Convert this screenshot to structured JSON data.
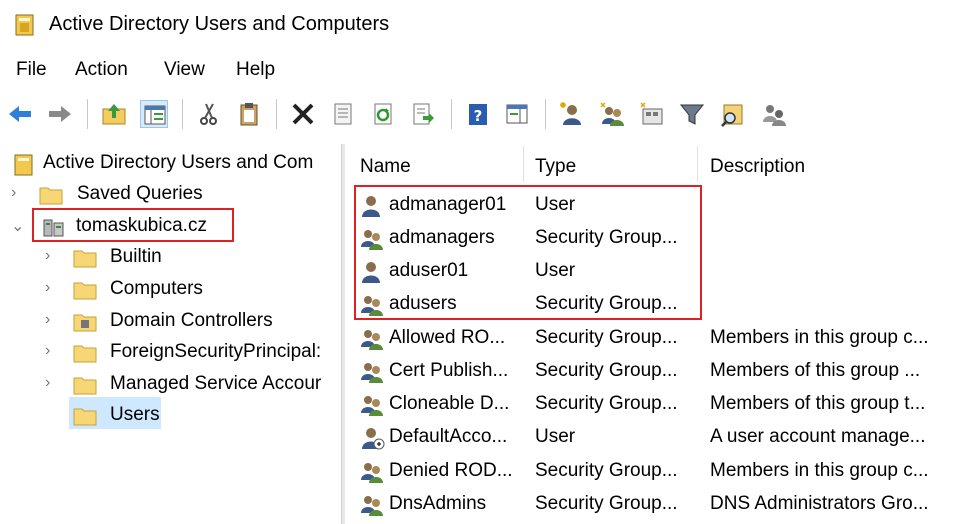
{
  "window": {
    "title": "Active Directory Users and Computers"
  },
  "menu": [
    "File",
    "Action",
    "View",
    "Help"
  ],
  "toolbar_icons": [
    "back-arrow-icon",
    "forward-arrow-icon",
    "up-folder-icon",
    "show-tree-icon",
    "cut-icon",
    "paste-icon",
    "delete-icon",
    "properties-icon",
    "refresh-icon",
    "export-list-icon",
    "help-icon",
    "action-pane-icon",
    "new-user-icon",
    "new-group-icon",
    "new-ou-icon",
    "filter-icon",
    "find-icon",
    "delegate-icon"
  ],
  "tree": {
    "root": "Active Directory Users and Com",
    "saved_queries": "Saved Queries",
    "domain": "tomaskubica.cz",
    "children": [
      "Builtin",
      "Computers",
      "Domain Controllers",
      "ForeignSecurityPrincipal:",
      "Managed Service Accour",
      "Users"
    ]
  },
  "list": {
    "columns": [
      "Name",
      "Type",
      "Description"
    ],
    "rows": [
      {
        "name": "admanager01",
        "type": "User",
        "description": "",
        "icon": "user-icon"
      },
      {
        "name": "admanagers",
        "type": "Security Group...",
        "description": "",
        "icon": "group-icon"
      },
      {
        "name": "aduser01",
        "type": "User",
        "description": "",
        "icon": "user-icon"
      },
      {
        "name": "adusers",
        "type": "Security Group...",
        "description": "",
        "icon": "group-icon"
      },
      {
        "name": "Allowed RO...",
        "type": "Security Group...",
        "description": "Members in this group c...",
        "icon": "group-icon"
      },
      {
        "name": "Cert Publish...",
        "type": "Security Group...",
        "description": "Members of this group ...",
        "icon": "group-icon"
      },
      {
        "name": "Cloneable D...",
        "type": "Security Group...",
        "description": "Members of this group t...",
        "icon": "group-icon"
      },
      {
        "name": "DefaultAcco...",
        "type": "User",
        "description": "A user account manage...",
        "icon": "disabled-user-icon"
      },
      {
        "name": "Denied ROD...",
        "type": "Security Group...",
        "description": "Members in this group c...",
        "icon": "group-icon"
      },
      {
        "name": "DnsAdmins",
        "type": "Security Group...",
        "description": "DNS Administrators Gro...",
        "icon": "group-icon"
      }
    ]
  },
  "accent": {
    "highlight_box": "#dd2222",
    "selection": "#cde8ff"
  }
}
